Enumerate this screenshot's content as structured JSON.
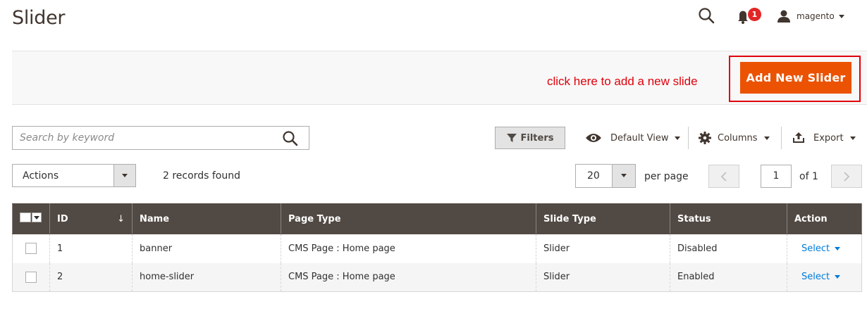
{
  "page": {
    "title": "Slider"
  },
  "header": {
    "notification_count": "1",
    "user_name": "magento"
  },
  "page_actions": {
    "hint": "click here to add a new slide",
    "add_button": "Add New Slider"
  },
  "toolbar": {
    "search_placeholder": "Search by keyword",
    "filters_label": "Filters",
    "view_label": "Default View",
    "columns_label": "Columns",
    "export_label": "Export",
    "actions_label": "Actions",
    "records_found": "2 records found",
    "per_page_value": "20",
    "per_page_label": "per page",
    "current_page": "1",
    "page_total": "of 1"
  },
  "grid": {
    "columns": [
      "ID",
      "Name",
      "Page Type",
      "Slide Type",
      "Status",
      "Action"
    ],
    "sort_indicator": "↓",
    "rows": [
      {
        "id": "1",
        "name": "banner",
        "page_type": "CMS Page : Home page",
        "slide_type": "Slider",
        "status": "Disabled",
        "action": "Select"
      },
      {
        "id": "2",
        "name": "home-slider",
        "page_type": "CMS Page : Home page",
        "slide_type": "Slider",
        "status": "Enabled",
        "action": "Select"
      }
    ]
  },
  "colors": {
    "accent": "#eb5202",
    "annotation": "#e0000b",
    "table_header": "#514943",
    "link": "#007bdb",
    "badge": "#e22626"
  },
  "icons": [
    "search-icon",
    "bell-icon",
    "user-icon",
    "filter-icon",
    "eye-icon",
    "gear-icon",
    "export-icon",
    "chevron-left-icon",
    "chevron-right-icon"
  ]
}
